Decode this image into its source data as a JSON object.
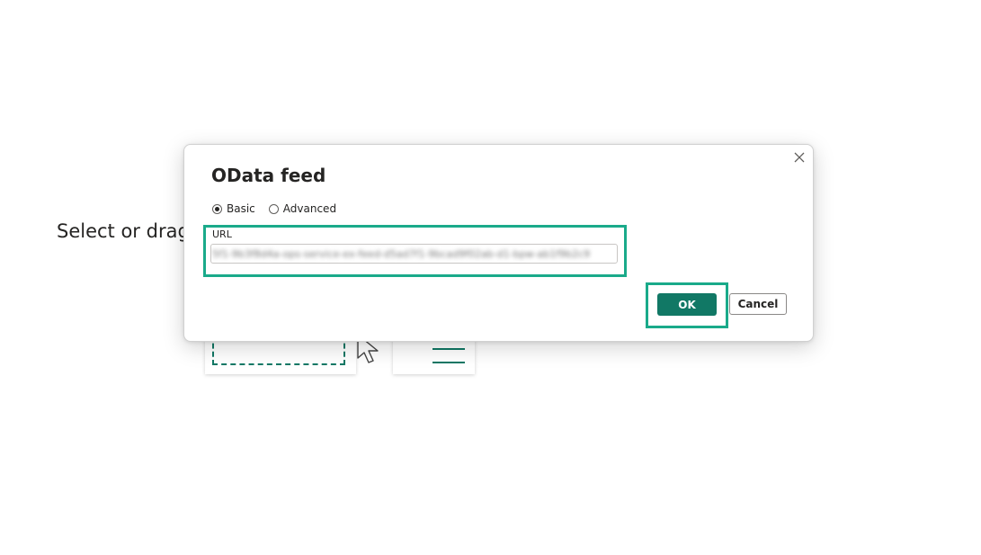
{
  "background": {
    "prompt_text": "Select or drag"
  },
  "dialog": {
    "title": "OData feed",
    "close_icon": "close-icon",
    "radio_options": [
      {
        "label": "Basic",
        "checked": true
      },
      {
        "label": "Advanced",
        "checked": false
      }
    ],
    "url_label": "URL",
    "url_value": "5f1-9b3f8d4a-ops-service-ex-feed-d5ad7f1-9bcad9f02ab-d1-bpw-ab1f9b2c9",
    "ok_label": "OK",
    "cancel_label": "Cancel"
  },
  "colors": {
    "accent": "#117865",
    "highlight": "#1aaa8a",
    "text": "#252423"
  }
}
